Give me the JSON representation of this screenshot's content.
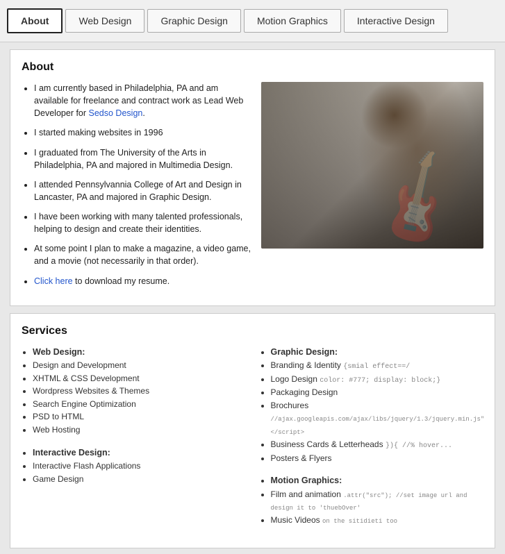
{
  "nav": {
    "tabs": [
      {
        "id": "about",
        "label": "About",
        "active": true
      },
      {
        "id": "web-design",
        "label": "Web Design",
        "active": false
      },
      {
        "id": "graphic-design",
        "label": "Graphic Design",
        "active": false
      },
      {
        "id": "motion-graphics",
        "label": "Motion Graphics",
        "active": false
      },
      {
        "id": "interactive-design",
        "label": "Interactive Design",
        "active": false
      }
    ]
  },
  "about": {
    "title": "About",
    "bullets": [
      "I am currently based in Philadelphia, PA and am available for freelance and contract work as Lead Web Developer for Sedso Design.",
      "I started making websites in 1996",
      "I graduated from The University of the Arts in Philadelphia, PA and majored in Multimedia Design.",
      "I attended Pennsylvannia College of Art and Design in Lancaster, PA and majored in Graphic Design.",
      "I have been working with many talented professionals, helping to design and create their identities.",
      "At some point I plan to make a magazine, a video game, and a movie (not necessarily in that order)."
    ],
    "resume_link": "Click here",
    "resume_text": " to download my resume.",
    "link_url": "#"
  },
  "services": {
    "title": "Services",
    "categories": [
      {
        "id": "web-design",
        "title": "Web Design:",
        "items": [
          "Design and Development",
          "XHTML & CSS Development",
          "Wordpress Websites & Themes",
          "Search Engine Optimization",
          "PSD to HTML",
          "Web Hosting"
        ]
      },
      {
        "id": "interactive-design",
        "title": "Interactive Design:",
        "items": [
          "Interactive Flash Applications",
          "Game Design"
        ]
      },
      {
        "id": "graphic-design",
        "title": "Graphic Design:",
        "items": [
          "Branding & Identity",
          "Logo Design",
          "Packaging Design",
          "Brochures",
          "Business Cards & Letterheads",
          "Posters & Flyers"
        ]
      },
      {
        "id": "motion-graphics",
        "title": "Motion Graphics:",
        "items": [
          "Film and animation",
          "Music Videos"
        ]
      }
    ]
  }
}
